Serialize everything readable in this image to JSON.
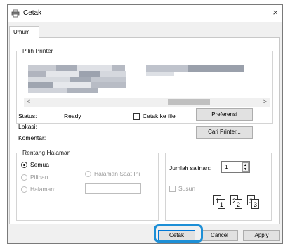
{
  "window": {
    "title": "Cetak",
    "close_glyph": "×"
  },
  "tabs": [
    {
      "label": "Umum"
    }
  ],
  "printer_group": {
    "label": "Pilih Printer"
  },
  "status": {
    "status_label": "Status:",
    "status_value": "Ready",
    "location_label": "Lokasi:",
    "comment_label": "Komentar:"
  },
  "print_to_file": {
    "label": "Cetak ke file",
    "checked": false
  },
  "buttons": {
    "preferences": "Preferensi",
    "find_printer": "Cari Printer...",
    "print": "Cetak",
    "cancel": "Cancel",
    "apply": "Apply"
  },
  "range_group": {
    "label": "Rentang Halaman",
    "all": "Semua",
    "selection": "Pilihan",
    "current_page": "Halaman Saat Ini",
    "pages": "Halaman:"
  },
  "copies": {
    "label": "Jumlah salinan:",
    "value": "1"
  },
  "collate": {
    "label": "Susun",
    "pages_a": [
      "1",
      "1"
    ],
    "pages_b": [
      "2",
      "2"
    ],
    "pages_c": [
      "3",
      "3"
    ]
  },
  "scroll": {
    "left": "<",
    "right": ">"
  },
  "icons": {
    "printer": "printer-icon",
    "close": "close-icon"
  },
  "colors": {
    "highlight": "#1d8fd6"
  }
}
